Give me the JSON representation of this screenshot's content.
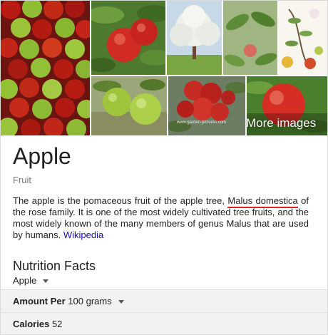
{
  "gallery": {
    "more_images_label": "More images",
    "watermark_text": "www.garden-pictures.com"
  },
  "entity": {
    "title": "Apple",
    "subtitle": "Fruit"
  },
  "description": {
    "text_before": "The apple is the pomaceous fruit of the apple tree, ",
    "highlight": "Malus domestica",
    "text_after": " of the rose family. It is one of the most widely cultivated tree fruits, and the most widely known of the many members of genus Malus that are used by humans. ",
    "source_link": "Wikipedia"
  },
  "nutrition": {
    "title": "Nutrition Facts",
    "food_select": "Apple",
    "amount_label": "Amount Per",
    "amount_value": "100 grams",
    "calories_label": "Calories",
    "calories_value": "52"
  },
  "colors": {
    "link": "#1a0dab",
    "highlight_underline": "#d8262d",
    "row_bg": "#f2f2f2"
  }
}
